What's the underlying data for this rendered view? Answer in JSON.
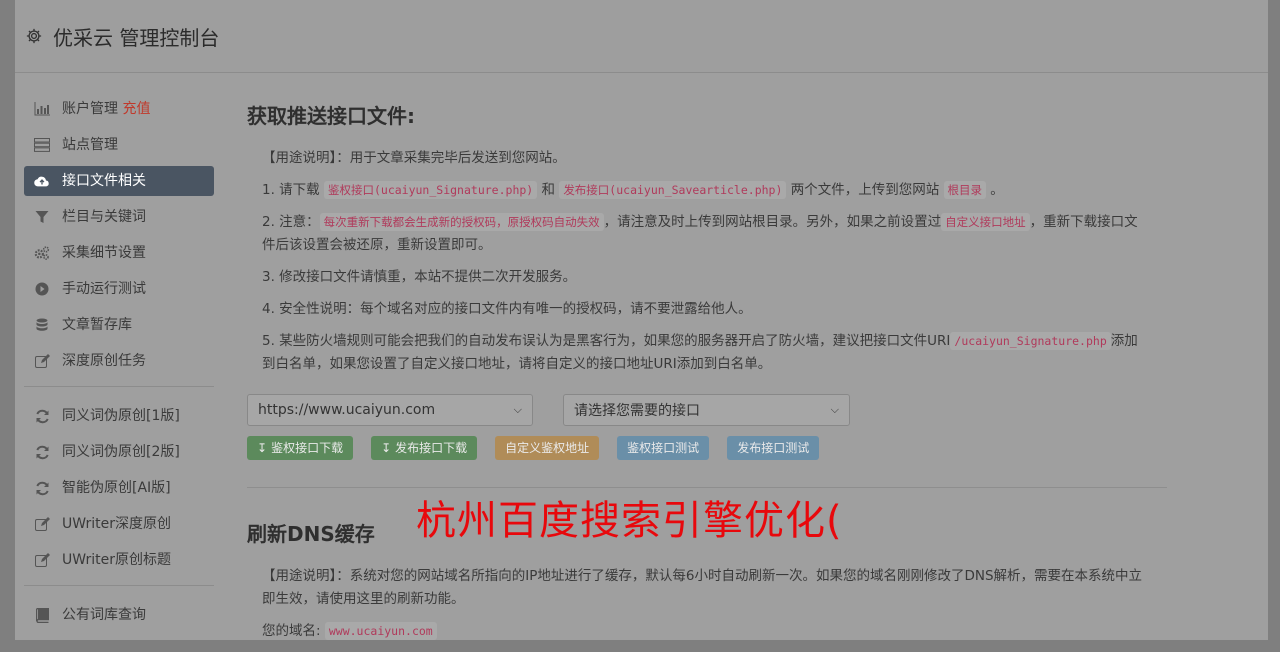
{
  "app": {
    "title": "优采云 管理控制台"
  },
  "sidebar": {
    "group1": [
      {
        "label": "账户管理",
        "extra": "充值",
        "icon": "bar-chart-icon",
        "active": false
      },
      {
        "label": "站点管理",
        "icon": "server-icon",
        "active": false
      },
      {
        "label": "接口文件相关",
        "icon": "cloud-upload-icon",
        "active": true
      },
      {
        "label": "栏目与关键词",
        "icon": "filter-icon",
        "active": false
      },
      {
        "label": "采集细节设置",
        "icon": "cogs-icon",
        "active": false
      },
      {
        "label": "手动运行测试",
        "icon": "play-circle-icon",
        "active": false
      },
      {
        "label": "文章暂存库",
        "icon": "database-icon",
        "active": false
      },
      {
        "label": "深度原创任务",
        "icon": "edit-icon",
        "active": false
      }
    ],
    "group2": [
      {
        "label": "同义词伪原创[1版]",
        "icon": "refresh-icon"
      },
      {
        "label": "同义词伪原创[2版]",
        "icon": "refresh-icon"
      },
      {
        "label": "智能伪原创[AI版]",
        "icon": "refresh-icon"
      },
      {
        "label": "UWriter深度原创",
        "icon": "edit-icon"
      },
      {
        "label": "UWriter原创标题",
        "icon": "edit-icon"
      }
    ],
    "group3": [
      {
        "label": "公有词库查询",
        "icon": "book-icon"
      }
    ]
  },
  "section1": {
    "title": "获取推送接口文件:",
    "usage": "【用途说明】：用于文章采集完毕后发送到您网站。",
    "p1": {
      "a": "1. 请下载",
      "c1": "鉴权接口(ucaiyun_Signature.php)",
      "b": "和",
      "c2": "发布接口(ucaiyun_Savearticle.php)",
      "c": "两个文件，上传到您网站",
      "c3": "根目录",
      "d": "。"
    },
    "p2": {
      "a": "2. 注意：",
      "c1": "每次重新下载都会生成新的授权码，原授权码自动失效",
      "b": "，请注意及时上传到网站根目录。另外，如果之前设置过",
      "c2": "自定义接口地址",
      "c": "，重新下载接口文件后该设置会被还原，重新设置即可。"
    },
    "p3": "3. 修改接口文件请慎重，本站不提供二次开发服务。",
    "p4": "4. 安全性说明：每个域名对应的接口文件内有唯一的授权码，请不要泄露给他人。",
    "p5": {
      "a": "5. 某些防火墙规则可能会把我们的自动发布误认为是黑客行为，如果您的服务器开启了防火墙，建议把接口文件URI",
      "c1": "/ucaiyun_Signature.php",
      "b": "添加到白名单，如果您设置了自定义接口地址，请将自定义的接口地址URI添加到白名单。"
    },
    "site_select": "https://www.ucaiyun.com",
    "api_select": "请选择您需要的接口",
    "buttons": {
      "dl_sign": "鉴权接口下载",
      "dl_publish": "发布接口下载",
      "custom_url": "自定义鉴权地址",
      "test_sign": "鉴权接口测试",
      "test_publish": "发布接口测试"
    }
  },
  "section2": {
    "title": "刷新DNS缓存",
    "usage": "【用途说明】：系统对您的网站域名所指向的IP地址进行了缓存，默认每6小时自动刷新一次。如果您的域名刚刚修改了DNS解析，需要在本系统中立即生效，请使用这里的刷新功能。",
    "domain_label": "您的域名:",
    "domain_value": "www.ucaiyun.com"
  },
  "overlay_text": "杭州百度搜索引擎优化("
}
